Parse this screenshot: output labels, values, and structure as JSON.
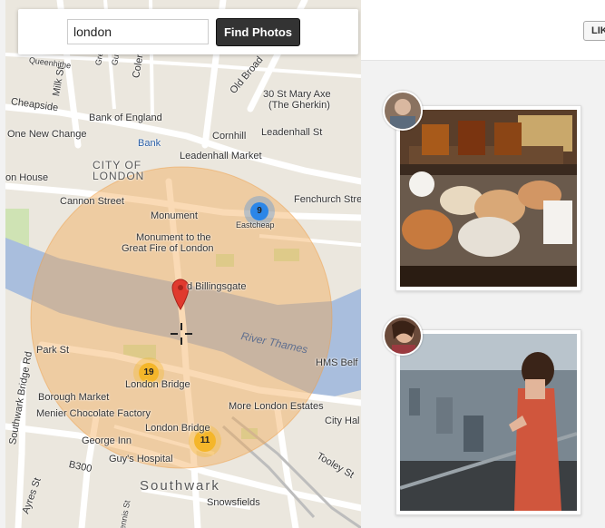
{
  "search": {
    "value": "london",
    "button_label": "Find Photos"
  },
  "map": {
    "labels": {
      "cheapside": "Cheapside",
      "bank_of_england": "Bank of England",
      "one_new_change": "One New Change",
      "bank": "Bank",
      "cornhill": "Cornhill",
      "leadenhall_st": "Leadenhall St",
      "leadenhall_market": "Leadenhall Market",
      "st_mary_axe": "30 St Mary Axe",
      "gherkin": "(The Gherkin)",
      "city_of": "CITY OF",
      "london": "LONDON",
      "house": "on House",
      "cannon_street": "Cannon Street",
      "fenchurch_st": "Fenchurch Stre",
      "monument": "Monument",
      "eastcheap": "Eastcheap",
      "monument_to": "Monument to the",
      "great_fire": "Great Fire of London",
      "billingsgate": "d Billingsgate",
      "river_thames": "River Thames",
      "park_st": "Park St",
      "hms_belfast": "HMS Belf",
      "borough_market": "Borough Market",
      "london_bridge": "London Bridge",
      "more_london": "More London Estates",
      "menier": "Menier Chocolate Factory",
      "city_hall": "City Hal",
      "london_bridge_2": "London Bridge",
      "george_inn": "George Inn",
      "guys_hospital": "Guy's Hospital",
      "southwark": "Southwark",
      "snowsfields": "Snowsfields",
      "tooley_st": "Tooley St",
      "southwark_bridge_rd": "Southwark Bridge Rd",
      "b300": "B300",
      "ayres_st": "Ayres St",
      "old_broad": "Old Broad",
      "milk_st": "Milk St",
      "coleman": "Coleman",
      "gresham": "Gresham",
      "guildhall": "Guildhall",
      "tennis_st": "Tennis St",
      "queenhithe": "Queenhithe"
    },
    "clusters": {
      "eastcheap": "9",
      "london_bridge": "19",
      "london_bridge_east": "11"
    },
    "colors": {
      "radius_fill": "#f4a84e",
      "water": "#a9bedd",
      "cluster_blue": "#2b86e8",
      "cluster_gold": "#f4b62a",
      "pin": "#e03a2e"
    }
  },
  "panel": {
    "like_label": "LIK"
  }
}
